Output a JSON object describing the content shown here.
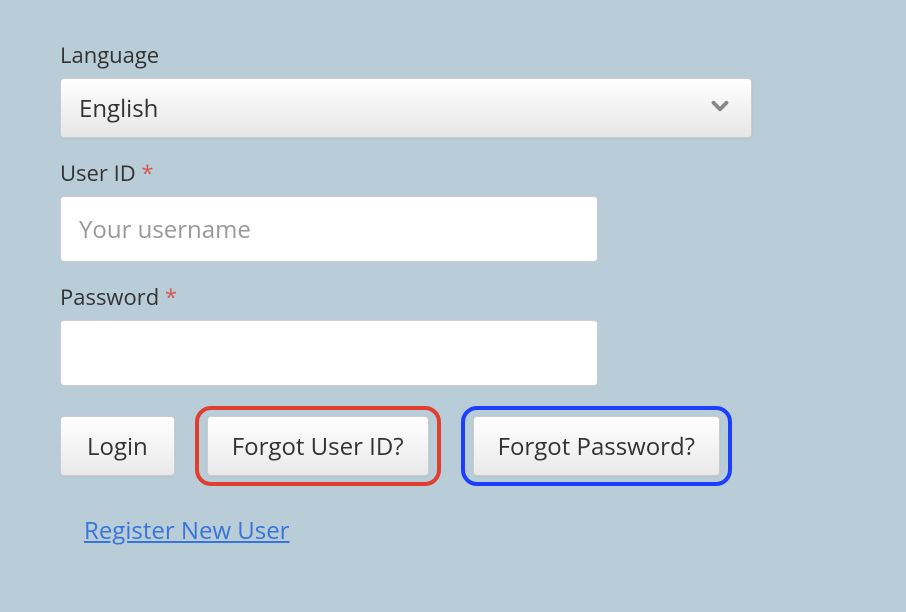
{
  "language": {
    "label": "Language",
    "selected": "English"
  },
  "userId": {
    "label": "User ID",
    "required": "*",
    "placeholder": "Your username",
    "value": ""
  },
  "password": {
    "label": "Password",
    "required": "*",
    "value": ""
  },
  "buttons": {
    "login": "Login",
    "forgotUserId": "Forgot User ID?",
    "forgotPassword": "Forgot Password?"
  },
  "links": {
    "register": "Register New User"
  }
}
